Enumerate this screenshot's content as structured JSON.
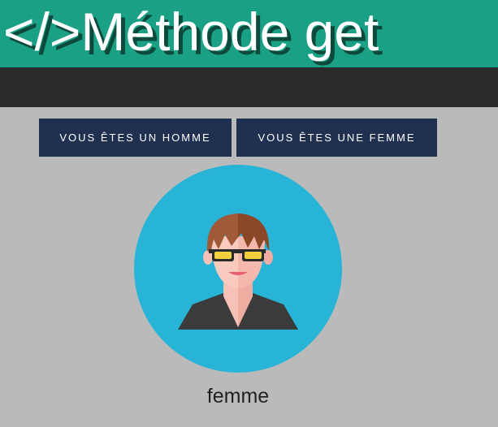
{
  "header": {
    "title": "</>Méthode get",
    "background_color": "#1aa085"
  },
  "navbar": {
    "background_color": "#2a2a2a"
  },
  "buttons": {
    "homme_label": "VOUS ÊTES UN HOMME",
    "femme_label": "VOUS ÊTES UNE FEMME",
    "color": "#203051"
  },
  "avatar": {
    "icon": "woman-avatar-icon",
    "circle_color": "#27b4d6"
  },
  "result": {
    "label": "femme"
  },
  "page": {
    "background_color": "#bababa"
  }
}
